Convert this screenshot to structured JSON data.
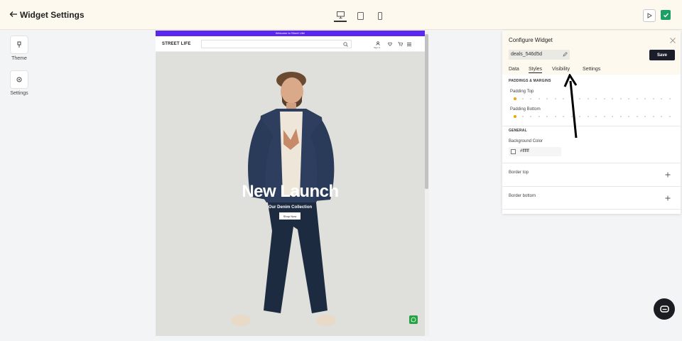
{
  "header": {
    "title": "Widget Settings",
    "devices": [
      "desktop-icon",
      "tablet-icon",
      "mobile-icon"
    ],
    "active_device": "desktop"
  },
  "rail": {
    "theme_label": "Theme",
    "settings_label": "Settings"
  },
  "preview": {
    "announcement": "Welcome to Street Life!",
    "logo": "STREET LIFE",
    "signin_label": "Sign In",
    "hero_title": "New Launch",
    "hero_subtitle": "Our Denim Collection",
    "cta_label": "Shop Now",
    "colors": {
      "announcement_bg": "#5a27f0",
      "whatsapp": "#25a244"
    }
  },
  "panel": {
    "title": "Configure Widget",
    "widget_id": "deals_546d5d",
    "save_label": "Save",
    "tabs": [
      "Data",
      "Styles",
      "Visibility",
      "Settings"
    ],
    "active_tab": "Styles",
    "paddings_heading": "PADDINGS & MARGINS",
    "padding_top_label": "Padding Top",
    "padding_top_value": 0,
    "padding_bottom_label": "Padding Bottom",
    "padding_bottom_value": 0,
    "general_heading": "GENERAL",
    "background_color_label": "Background Color",
    "background_color_value": "#ffffff",
    "border_top_label": "Border top",
    "border_bottom_label": "Border bottom",
    "colors": {
      "save_bg": "#1c1d2b",
      "accent": "#f0a500",
      "confirm": "#1f9f68"
    }
  }
}
